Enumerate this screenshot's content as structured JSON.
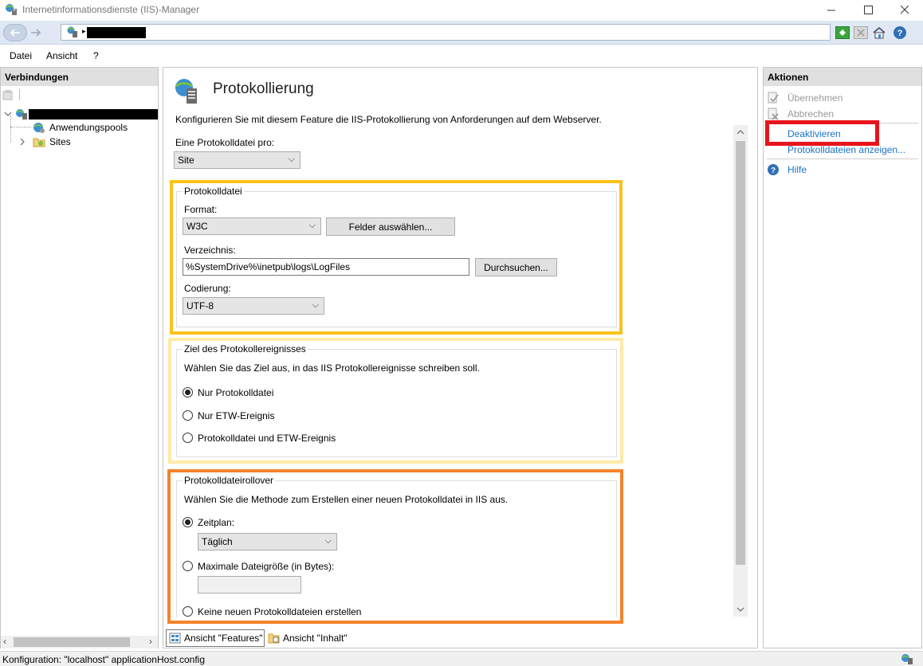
{
  "window": {
    "title": "Internetinformationsdienste (IIS)-Manager",
    "controls": [
      "minimize",
      "maximize",
      "close"
    ]
  },
  "address": {
    "icons": [
      "server-icon"
    ],
    "toolbar_icons": [
      "refresh-icon",
      "stop-icon",
      "home-icon",
      "help-icon"
    ]
  },
  "menu": {
    "items": [
      "Datei",
      "Ansicht",
      "?"
    ]
  },
  "connections": {
    "header": "Verbindungen",
    "tree": [
      {
        "label": "Anwendungspools",
        "icon": "app-pool-icon"
      },
      {
        "label": "Sites",
        "icon": "sites-folder-icon"
      }
    ]
  },
  "main": {
    "title": "Protokollierung",
    "description": "Konfigurieren Sie mit diesem Feature die IIS-Protokollierung von Anforderungen auf dem Webserver.",
    "per_label": "Eine Protokolldatei pro:",
    "per_value": "Site",
    "logfile_group": {
      "label": "Protokolldatei",
      "format_label": "Format:",
      "format_value": "W3C",
      "fields_button": "Felder auswählen...",
      "directory_label": "Verzeichnis:",
      "directory_value": "%SystemDrive%\\inetpub\\logs\\LogFiles",
      "browse_button": "Durchsuchen...",
      "encoding_label": "Codierung:",
      "encoding_value": "UTF-8",
      "highlight_color": "#fbc21b"
    },
    "target_group": {
      "label": "Ziel des Protokollereignisses",
      "description": "Wählen Sie das Ziel aus, in das IIS Protokollereignisse schreiben soll.",
      "options": [
        "Nur Protokolldatei",
        "Nur ETW-Ereignis",
        "Protokolldatei und ETW-Ereignis"
      ],
      "selected": "Nur Protokolldatei",
      "highlight_color": "#fdeaa7"
    },
    "rollover_group": {
      "label": "Protokolldateirollover",
      "description": "Wählen Sie die Methode zum Erstellen einer neuen Protokolldatei in IIS aus.",
      "schedule_label": "Zeitplan:",
      "schedule_value": "Täglich",
      "maxsize_label": "Maximale Dateigröße (in Bytes):",
      "maxsize_value": "",
      "none_label": "Keine neuen Protokolldateien erstellen",
      "selected": "Zeitplan:",
      "highlight_color": "#f5832a"
    },
    "tabs": [
      "Ansicht \"Features\"",
      "Ansicht \"Inhalt\""
    ]
  },
  "actions": {
    "header": "Aktionen",
    "apply": "Übernehmen",
    "cancel": "Abbrechen",
    "disable": "Deaktivieren",
    "view_logs": "Protokolldateien anzeigen...",
    "help": "Hilfe",
    "disable_highlight_color": "#e8141c",
    "link_color": "#1a73c7"
  },
  "status": {
    "text": "Konfiguration: \"localhost\" applicationHost.config"
  }
}
